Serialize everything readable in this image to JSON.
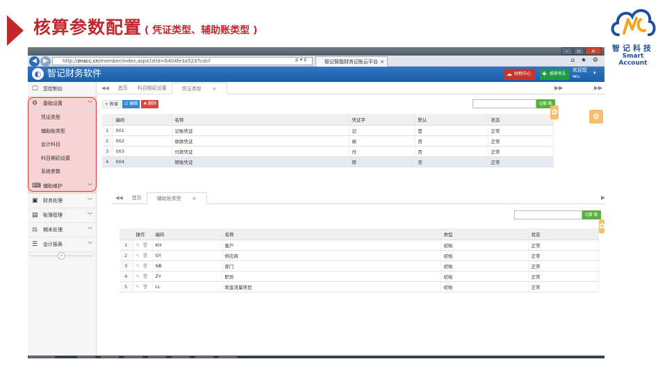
{
  "slide": {
    "title": "核算参数配置",
    "subtitle": "( 凭证类型、辅助账类型 )",
    "accent": "#c0282d"
  },
  "logo": {
    "cn": "智记科技",
    "en": "Smart Account",
    "color": "#1f4f9c"
  },
  "browser": {
    "url_prefix": "http://",
    "url_host": "znacc.cn",
    "url_path": "/member/index.aspx?ztId=6404fe3a5237cdcf",
    "url_controls": "ρ ▾ ¢",
    "tab_title": "智记智能财务记账云平台",
    "tab_close": "×",
    "right_icons": "⌂ ★ ⚙",
    "window_controls": [
      "–",
      "▫",
      "×"
    ]
  },
  "app": {
    "name": "智记财务软件",
    "logo_glyph": "◐",
    "btn_finance": "财税中心",
    "btn_recommend": "推荐有礼",
    "welcome": "欢迎您",
    "user": "wu",
    "header_color": "#2468b6"
  },
  "sidebar": {
    "items": [
      {
        "label": "您控制台",
        "icon": "monitor-icon",
        "glyph": "🖵"
      },
      {
        "label": "基础设置",
        "icon": "gears-icon",
        "glyph": "⚙",
        "chevron": "﹀"
      },
      {
        "label": "凭证类型"
      },
      {
        "label": "辅助账类型"
      },
      {
        "label": "会计科目"
      },
      {
        "label": "科目期初设置"
      },
      {
        "label": "系统参数"
      },
      {
        "label": "辅助维护",
        "icon": "keyboard-icon",
        "glyph": "⌨",
        "chevron": "﹀"
      },
      {
        "label": "财务处理",
        "icon": "money-icon",
        "glyph": "▣",
        "chevron": "﹀"
      },
      {
        "label": "账簿管理",
        "icon": "book-icon",
        "glyph": "▤",
        "chevron": "﹀"
      },
      {
        "label": "期末处理",
        "icon": "scale-icon",
        "glyph": "⚖",
        "chevron": "﹀"
      },
      {
        "label": "会计报表",
        "icon": "list-icon",
        "glyph": "☰",
        "chevron": "﹀"
      }
    ],
    "collapse_glyph": "«"
  },
  "panel1": {
    "tab_prev": "◀◀",
    "tabs": [
      "首页",
      "科目期初设置",
      "凭证类型"
    ],
    "tab_close": "⊗",
    "tab_next": "▶▶",
    "outer_next": "▶▶",
    "btn_add": "+ 新增",
    "btn_edit": "☑ 编辑",
    "btn_delete": "✖ 删除",
    "search_btn": "Q搜 索",
    "columns": [
      "",
      "编码",
      "名称",
      "凭证字",
      "默认",
      "状态"
    ],
    "rows": [
      {
        "n": "1",
        "code": "001",
        "name": "记账凭证",
        "word": "记",
        "default": "是",
        "status": "正常"
      },
      {
        "n": "2",
        "code": "002",
        "name": "收款凭证",
        "word": "收",
        "default": "否",
        "status": "正常"
      },
      {
        "n": "3",
        "code": "003",
        "name": "付款凭证",
        "word": "付",
        "default": "否",
        "status": "正常"
      },
      {
        "n": "4",
        "code": "004",
        "name": "转账凭证",
        "word": "转",
        "default": "否",
        "status": "正常"
      }
    ]
  },
  "panel2": {
    "tab_prev": "◀◀",
    "tabs": [
      "首页",
      "辅助账类型"
    ],
    "tab_close": "⊗",
    "tab_next": "▶",
    "search_btn": "Q搜 索",
    "columns": [
      "",
      "操作",
      "编码",
      "名称",
      "类型",
      "状态"
    ],
    "op_icons": "✎ 🗑",
    "rows": [
      {
        "n": "1",
        "code": "KH",
        "name": "客户",
        "type": "初始",
        "status": "正常"
      },
      {
        "n": "2",
        "code": "GY",
        "name": "供应商",
        "type": "初始",
        "status": "正常"
      },
      {
        "n": "3",
        "code": "NB",
        "name": "部门",
        "type": "初始",
        "status": "正常"
      },
      {
        "n": "4",
        "code": "ZY",
        "name": "职员",
        "type": "初始",
        "status": "正常"
      },
      {
        "n": "5",
        "code": "LL",
        "name": "现金流量项目",
        "type": "初始",
        "status": "正常"
      }
    ]
  },
  "gear_glyph": "✿"
}
